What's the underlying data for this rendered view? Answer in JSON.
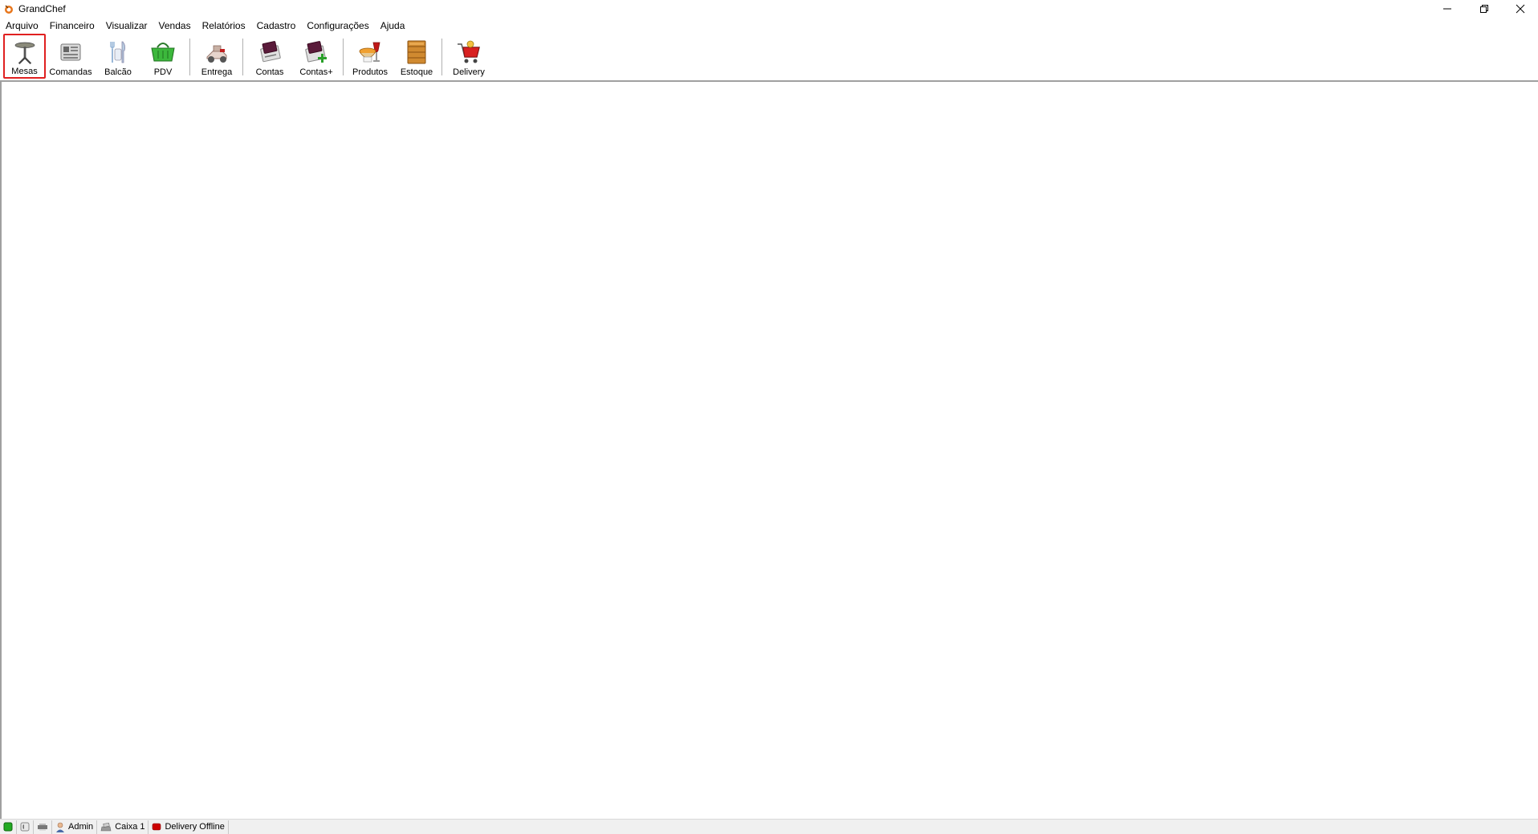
{
  "window": {
    "title": "GrandChef",
    "app_icon": "grandchef-logo-icon",
    "controls": [
      "minimize-icon",
      "restore-icon",
      "close-icon"
    ]
  },
  "menu": {
    "items": [
      {
        "label": "Arquivo"
      },
      {
        "label": "Financeiro"
      },
      {
        "label": "Visualizar"
      },
      {
        "label": "Vendas"
      },
      {
        "label": "Relatórios"
      },
      {
        "label": "Cadastro"
      },
      {
        "label": "Configurações"
      },
      {
        "label": "Ajuda"
      }
    ]
  },
  "toolbar": {
    "selected": "Mesas",
    "buttons": [
      {
        "label": "Mesas",
        "icon": "table-icon"
      },
      {
        "label": "Comandas",
        "icon": "order-pad-icon"
      },
      {
        "label": "Balcão",
        "icon": "counter-cutlery-icon"
      },
      {
        "label": "PDV",
        "icon": "shopping-basket-icon"
      },
      {
        "label": "Entrega",
        "icon": "delivery-scooter-icon"
      },
      {
        "label": "Contas",
        "icon": "accounts-icon"
      },
      {
        "label": "Contas+",
        "icon": "accounts-plus-icon"
      },
      {
        "label": "Produtos",
        "icon": "products-icon"
      },
      {
        "label": "Estoque",
        "icon": "stock-box-icon"
      },
      {
        "label": "Delivery",
        "icon": "delivery-cart-icon"
      }
    ]
  },
  "status": {
    "connection_icon": "connection-status-icon",
    "phone_icon": "phone-icon",
    "printer_icon": "printer-icon",
    "user": "Admin",
    "cashier": "Caixa 1",
    "delivery": "Delivery Offline",
    "colors": {
      "connection": "#22aa22",
      "delivery_offline": "#cc0000",
      "selection_border": "#e02020"
    }
  }
}
